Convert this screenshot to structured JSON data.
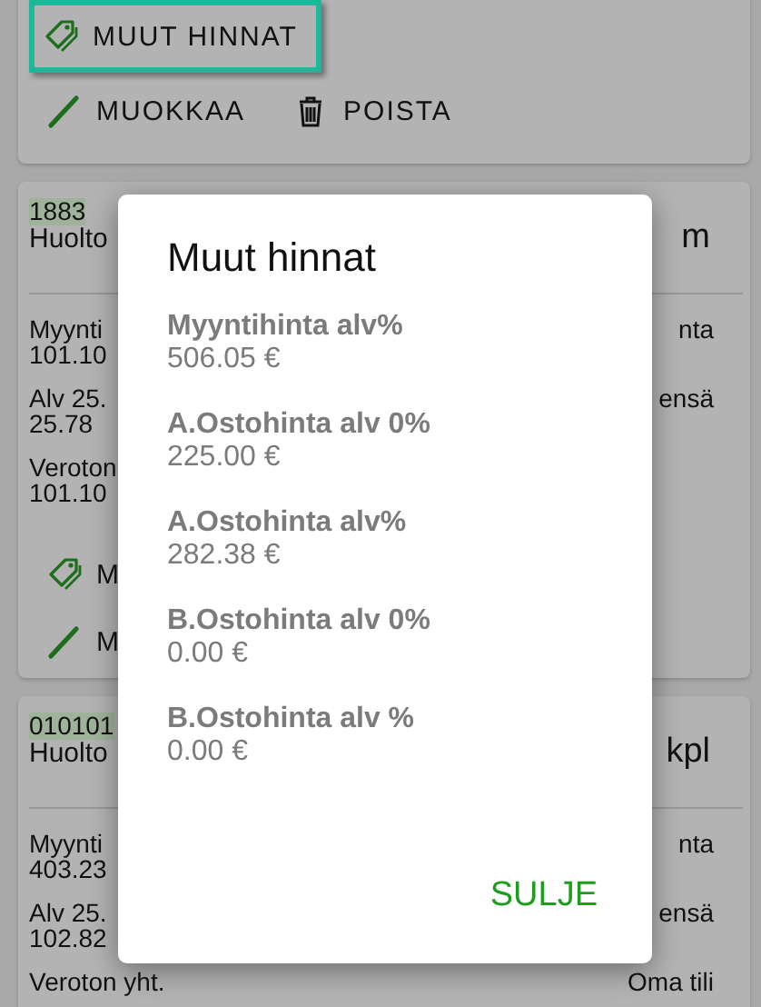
{
  "cards": [
    {
      "kind": "actions",
      "buttons": [
        {
          "label": "MUUT HINNAT",
          "kind": "tag",
          "focused": true
        }
      ],
      "actions": [
        {
          "label": "MUOKKAA",
          "kind": "pencil"
        },
        {
          "label": "POISTA",
          "kind": "trash"
        }
      ]
    },
    {
      "kind": "item",
      "code": "1883",
      "name": "Huolto",
      "unit": "m",
      "fields": [
        {
          "label": "Myynti",
          "value": "101.10"
        },
        {
          "label": "Alv 25.",
          "value": "25.78"
        },
        {
          "label": "Veroton",
          "value": "101.10"
        }
      ],
      "right": [
        "nta",
        "ensä"
      ],
      "actions": [
        {
          "label": "M",
          "kind": "tag"
        },
        {
          "label": "M",
          "kind": "pencil"
        }
      ]
    },
    {
      "kind": "item",
      "code": "010101",
      "name": "Huolto",
      "unit": "kpl",
      "fields": [
        {
          "label": "Myynti",
          "value": "403.23"
        },
        {
          "label": "Alv 25.",
          "value": "102.82"
        },
        {
          "label": "Veroton yht."
        }
      ],
      "right": [
        "nta",
        "ensä",
        "Oma tili"
      ]
    }
  ],
  "dialog": {
    "title": "Muut hinnat",
    "prices": [
      {
        "label": "Myyntihinta alv%",
        "value": "506.05 €"
      },
      {
        "label": "A.Ostohinta alv 0%",
        "value": "225.00 €"
      },
      {
        "label": "A.Ostohinta alv%",
        "value": "282.38 €"
      },
      {
        "label": "B.Ostohinta alv 0%",
        "value": "0.00 €"
      },
      {
        "label": "B.Ostohinta alv %",
        "value": "0.00 €"
      }
    ],
    "close": "SULJE"
  }
}
